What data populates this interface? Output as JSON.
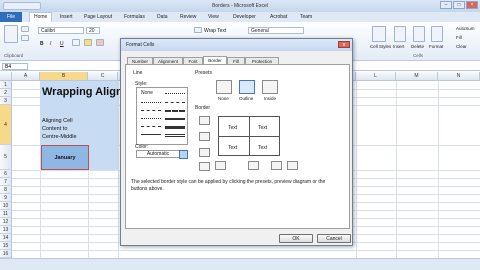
{
  "window": {
    "title": "Borders - Microsoft Excel"
  },
  "ribbon_tabs": [
    "File",
    "Home",
    "Insert",
    "Page Layout",
    "Formulas",
    "Data",
    "Review",
    "View",
    "Developer",
    "Acrobat",
    "Team"
  ],
  "ribbon": {
    "font_name": "Calibri",
    "font_size": "20",
    "wrap_text": "Wrap Text",
    "number_format": "General",
    "groups": {
      "clipboard": "Clipboard",
      "cells": "Cells"
    },
    "cells_buttons": [
      "Insert",
      "Delete",
      "Format"
    ],
    "styles_button": "Cell Styles",
    "editing": {
      "autosum": "AutoSum",
      "fill": "Fill",
      "clear": "Clear"
    },
    "bold": "B",
    "italic": "I",
    "underline": "U"
  },
  "formula_bar": {
    "name_box": "B4"
  },
  "columns": [
    "A",
    "B",
    "C",
    "L",
    "M",
    "N"
  ],
  "rows": [
    "1",
    "2",
    "3",
    "4",
    "5",
    "6",
    "7",
    "8",
    "9",
    "10",
    "11",
    "12",
    "13",
    "14",
    "15",
    "16",
    "17",
    "18",
    "19",
    "20"
  ],
  "sheet": {
    "title_cell": "Wrapping Align",
    "body_lines": [
      "Aligning Cell",
      "Content to",
      "Centre-Middle"
    ],
    "january": "January"
  },
  "dialog": {
    "title": "Format Cells",
    "close": "x",
    "tabs": [
      "Number",
      "Alignment",
      "Font",
      "Border",
      "Fill",
      "Protection"
    ],
    "active_tab": "Border",
    "line_label": "Line",
    "style_label": "Style:",
    "none_label": "None",
    "color_label": "Color:",
    "color_value": "Automatic",
    "presets_label": "Presets",
    "preset_buttons": [
      "None",
      "Outline",
      "Inside"
    ],
    "border_label": "Border",
    "preview_text": [
      "Text",
      "Text",
      "Text",
      "Text"
    ],
    "description": "The selected border style can be applied by clicking the presets, preview diagram or the buttons above.",
    "ok": "OK",
    "cancel": "Cancel"
  }
}
